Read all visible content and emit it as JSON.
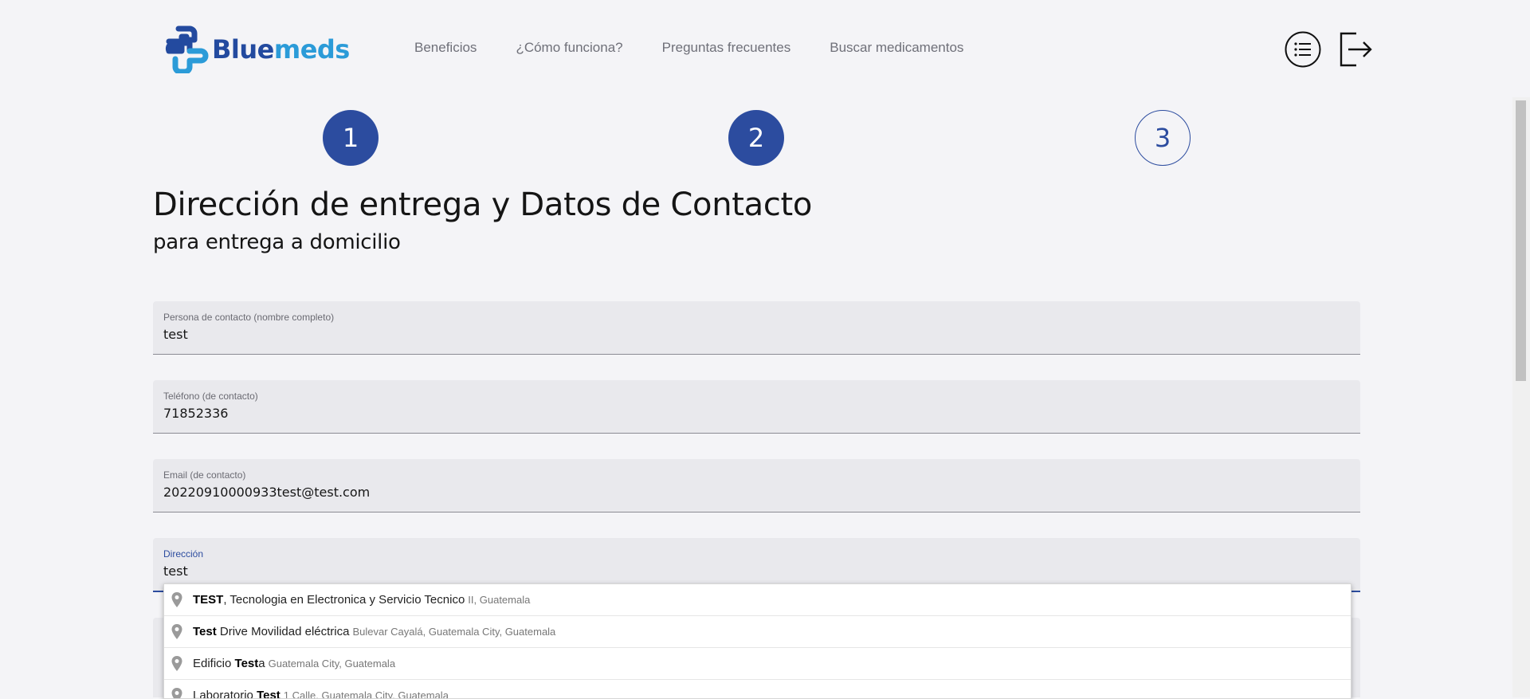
{
  "brand": {
    "name_part1": "Blue",
    "name_part2": "meds",
    "color_primary": "#234a9f",
    "color_accent": "#2b9bd8"
  },
  "nav": {
    "items": [
      "Beneficios",
      "¿Cómo funciona?",
      "Preguntas frecuentes",
      "Buscar medicamentos"
    ]
  },
  "header_icons": {
    "menu": "list-menu-icon",
    "logout": "logout-icon"
  },
  "steps": [
    {
      "label": "1",
      "state": "completed"
    },
    {
      "label": "2",
      "state": "current"
    },
    {
      "label": "3",
      "state": "pending"
    }
  ],
  "page": {
    "title": "Dirección de entrega y Datos de Contacto",
    "subtitle": "para entrega a domicilio"
  },
  "form": {
    "contact_name": {
      "label": "Persona de contacto (nombre completo)",
      "value": "test"
    },
    "phone": {
      "label": "Teléfono (de contacto)",
      "value": "71852336"
    },
    "email": {
      "label": "Email (de contacto)",
      "value": "20220910000933test@test.com"
    },
    "address": {
      "label": "Dirección",
      "value": "test"
    }
  },
  "autocomplete": {
    "suggestions": [
      {
        "match": "TEST",
        "rest": ", Tecnologia en Electronica y Servicio Tecnico",
        "secondary": "II, Guatemala"
      },
      {
        "match": "Test",
        "rest": " Drive Movilidad eléctrica",
        "secondary": "Bulevar Cayalá, Guatemala City, Guatemala"
      },
      {
        "prefix": "Edificio ",
        "match": "Test",
        "rest": "a",
        "secondary": "Guatemala City, Guatemala"
      },
      {
        "prefix": "Laboratorio ",
        "match": "Test",
        "rest": "",
        "secondary": "1 Calle, Guatemala City, Guatemala"
      }
    ]
  }
}
